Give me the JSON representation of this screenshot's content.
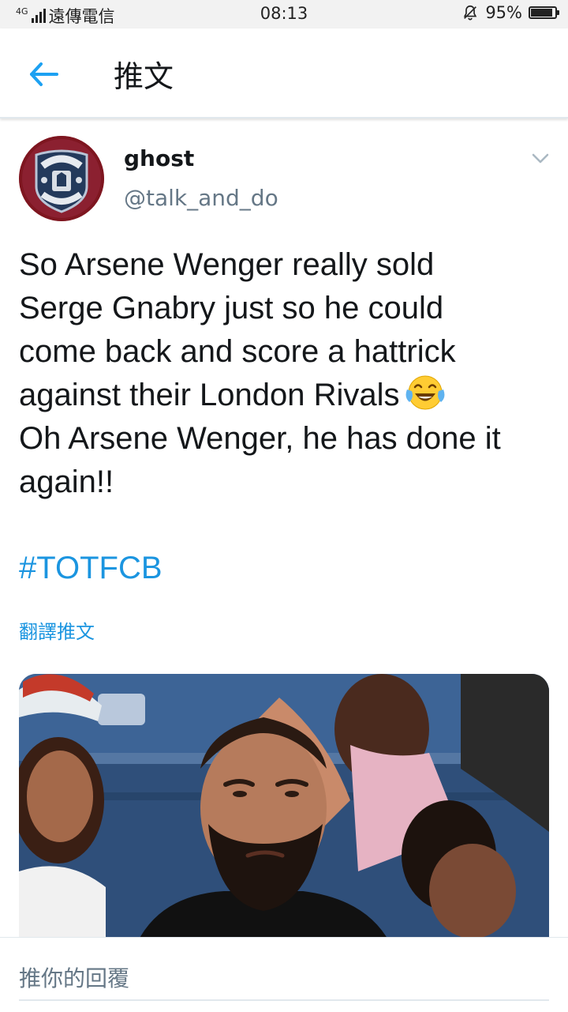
{
  "status_bar": {
    "network_type": "4G",
    "carrier": "遠傳電信",
    "time": "08:13",
    "mute_icon": "bell-off-icon",
    "battery_percent": "95%",
    "battery_level": 0.95
  },
  "header": {
    "back_icon": "arrow-left-icon",
    "title": "推文"
  },
  "tweet": {
    "avatar_icon": "manchester-united-crest",
    "display_name": "ghost",
    "handle": "@talk_and_do",
    "menu_icon": "chevron-down-icon",
    "text_lines": [
      "So Arsene Wenger really sold",
      "Serge Gnabry just so he could",
      "come back and score a hattrick",
      "against their London Rivals",
      "Oh Arsene Wenger, he has done it",
      "again!!"
    ],
    "emoji": "face-with-tears-of-joy",
    "hashtag": "#TOTFCB",
    "translate_label": "翻譯推文",
    "media_description": "photo"
  },
  "reply": {
    "placeholder": "推你的回覆"
  },
  "colors": {
    "link": "#1b95e0",
    "secondary_text": "#657786",
    "primary_text": "#14171a",
    "divider": "#e1e8ed"
  }
}
